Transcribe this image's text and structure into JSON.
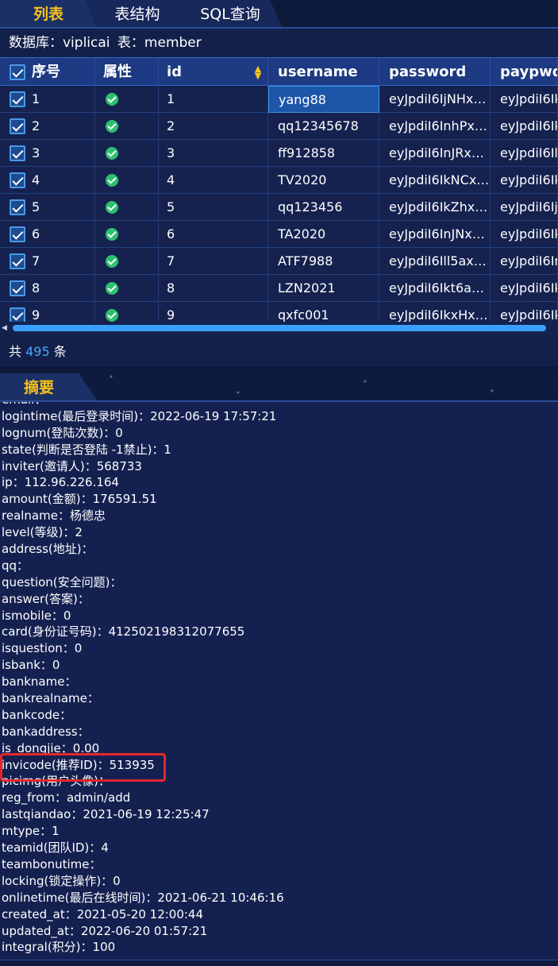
{
  "tabs": [
    {
      "label": "列表"
    },
    {
      "label": "表结构"
    },
    {
      "label": "SQL查询"
    }
  ],
  "db_info": {
    "db_label": "数据库：viplicai",
    "table_label": "表：member"
  },
  "grid": {
    "columns": [
      "序号",
      "属性",
      "id",
      "username",
      "password",
      "paypwd"
    ],
    "rows": [
      {
        "idx": "1",
        "id": "1",
        "username": "yang88",
        "password": "eyJpdiI6IjNHxxxx",
        "paypwd": "eyJpdiI6Ik"
      },
      {
        "idx": "2",
        "id": "2",
        "username": "qq12345678",
        "password": "eyJpdiI6InhPxxxx",
        "paypwd": "eyJpdiI6Ik"
      },
      {
        "idx": "3",
        "id": "3",
        "username": "ff912858",
        "password": "eyJpdiI6InJRxxxx",
        "paypwd": "eyJpdiI6Il"
      },
      {
        "idx": "4",
        "id": "4",
        "username": "TV2020",
        "password": "eyJpdiI6IkNCxxxx",
        "paypwd": "eyJpdiI6Ik"
      },
      {
        "idx": "5",
        "id": "5",
        "username": "qq123456",
        "password": "eyJpdiI6IkZhxxxx",
        "paypwd": "eyJpdiI6Ij"
      },
      {
        "idx": "6",
        "id": "6",
        "username": "TA2020",
        "password": "eyJpdiI6InJNxxxx",
        "paypwd": "eyJpdiI6Ik"
      },
      {
        "idx": "7",
        "id": "7",
        "username": "ATF7988",
        "password": "eyJpdiI6Ill5axxxx",
        "paypwd": "eyJpdiI6In"
      },
      {
        "idx": "8",
        "id": "8",
        "username": "LZN2021",
        "password": "eyJpdiI6Ikt6axxxx",
        "paypwd": "eyJpdiI6Ik"
      },
      {
        "idx": "9",
        "id": "9",
        "username": "qxfc001",
        "password": "eyJpdiI6IkxHxxxx",
        "paypwd": "eyJpdiI6Ik"
      }
    ]
  },
  "total": {
    "prefix": "共",
    "count": "495",
    "suffix": "条"
  },
  "summary": {
    "tab_label": "摘要",
    "lines": [
      "email：",
      "logintime(最后登录时间)：2022-06-19 17:57:21",
      "lognum(登陆次数)：0",
      "state(判断是否登陆 -1禁止)：1",
      "inviter(邀请人)：568733",
      "ip：112.96.226.164",
      "amount(金额)：176591.51",
      "realname：杨德忠",
      "level(等级)：2",
      "address(地址)：",
      "qq：",
      "question(安全问题)：",
      "answer(答案)：",
      "ismobile：0",
      "card(身份证号码)：412502198312077655",
      "isquestion：0",
      "isbank：0",
      "bankname：",
      "bankrealname：",
      "bankcode：",
      "bankaddress：",
      "is_dongjie：0.00",
      "invicode(推荐ID)：513935",
      "picimg(用户头像)：",
      "reg_from：admin/add",
      "lastqiandao：2021-06-19 12:25:47",
      "mtype：1",
      "teamid(团队ID)：4",
      "teambonutime：",
      "locking(锁定操作)：0",
      "onlinetime(最后在线时间)：2021-06-21 10:46:16",
      "created_at：2021-05-20 12:00:44",
      "updated_at：2022-06-20 01:57:21",
      "integral(积分)：100"
    ]
  },
  "colors": {
    "accent": "#f5c21b",
    "background": "#12204a",
    "header": "#1d3a82",
    "selection": "#1d56a8",
    "count": "#4aa8ff",
    "ok": "#2ec071",
    "highlight": "#e8262a"
  }
}
